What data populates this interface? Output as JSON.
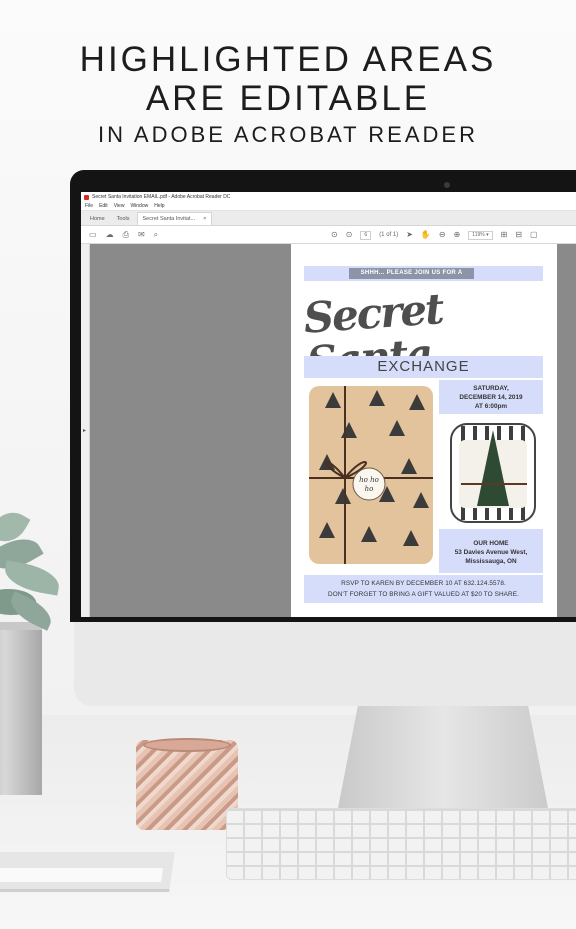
{
  "headline": {
    "line1": "HIGHLIGHTED AREAS",
    "line2": "ARE EDITABLE",
    "line3": "IN ADOBE ACROBAT READER"
  },
  "window": {
    "title": "Secret Santa Invitation EMAIL.pdf - Adobe Acrobat Reader DC",
    "menu": [
      "File",
      "Edit",
      "View",
      "Window",
      "Help"
    ],
    "tabs": {
      "home": "Home",
      "tools": "Tools",
      "document": "Secret Santa Invitat...",
      "close": "×"
    }
  },
  "toolbar": {
    "page_number": "6",
    "page_count": "(1 of 1)",
    "zoom": "119%"
  },
  "invitation": {
    "ribbon": "SHHH... PLEASE JOIN US FOR A",
    "script_title": "Secret Santa",
    "exchange": "EXCHANGE",
    "date_line1": "SATURDAY,",
    "date_line2": "DECEMBER 14, 2019",
    "date_line3": "AT 6:00pm",
    "tag_line1": "ho ho",
    "tag_line2": "ho",
    "place_line1": "OUR HOME",
    "place_line2": "53 Davies Avenue West,",
    "place_line3": "Mississauga, ON",
    "rsvp_line1": "RSVP TO KAREN BY DECEMBER 10 AT 632.124.5578.",
    "rsvp_line2": "DON'T FORGET TO BRING A GIFT VALUED AT $20 TO SHARE."
  },
  "colors": {
    "highlight": "#d6ddfa",
    "ribbon": "#8e94a8",
    "acrobat_red": "#d9281c"
  }
}
